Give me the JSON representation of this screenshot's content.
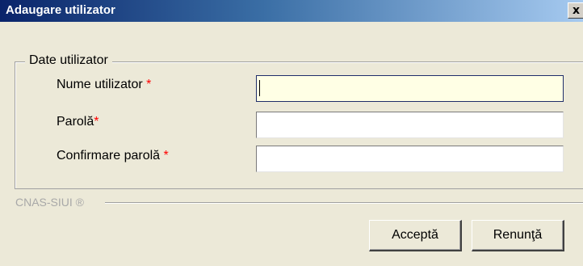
{
  "window": {
    "title": "Adaugare utilizator",
    "close_glyph": "x"
  },
  "form": {
    "group_label": "Date utilizator",
    "required_marker": "*",
    "fields": [
      {
        "label": "Nume utilizator",
        "value": "",
        "focused": true
      },
      {
        "label": "Parolă",
        "value": "",
        "focused": false
      },
      {
        "label": "Confirmare parolă",
        "value": "",
        "focused": false
      }
    ]
  },
  "footer": {
    "brand": "CNAS-SIUI ®"
  },
  "buttons": {
    "accept_label": "Acceptă",
    "cancel_label": "Renunţă"
  },
  "colors": {
    "title_gradient_start": "#0a246a",
    "title_gradient_end": "#a6caf0",
    "focused_input_bg": "#ffffe5",
    "required_marker": "#ff0000"
  }
}
